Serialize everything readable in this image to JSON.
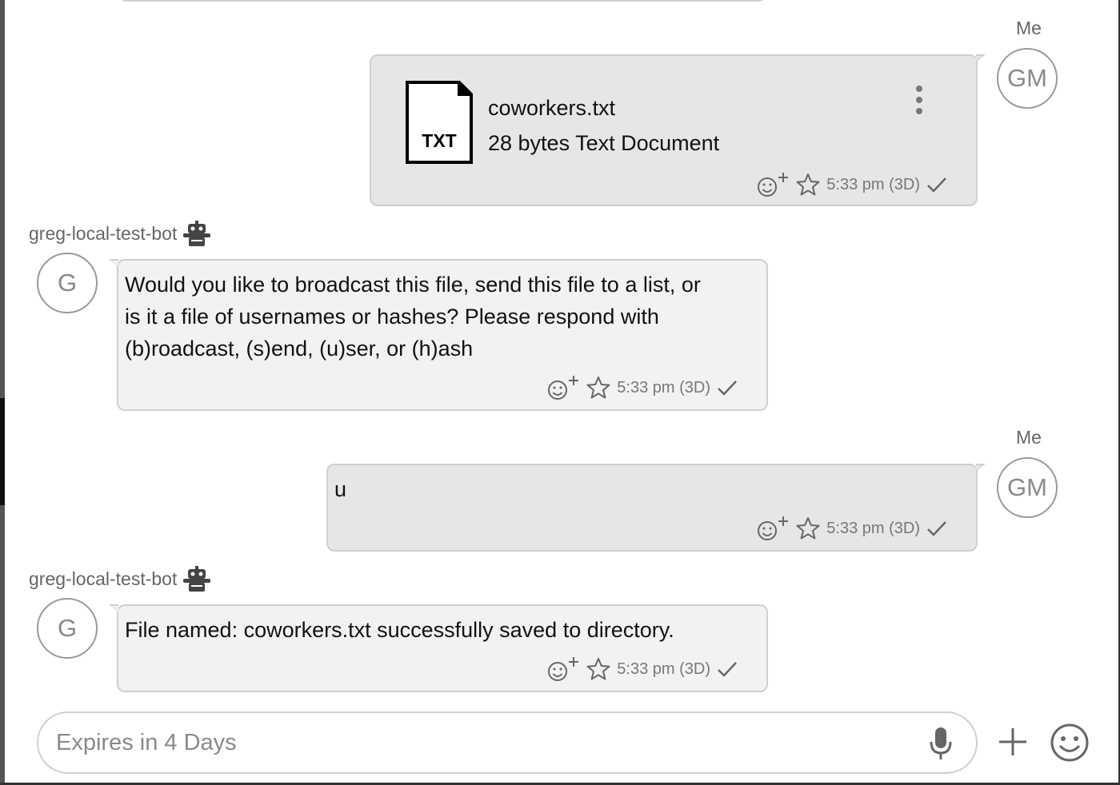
{
  "messages": [
    {
      "kind": "file",
      "sender": "Me",
      "avatar": "GM",
      "file": {
        "type_label": "TXT",
        "name": "coworkers.txt",
        "info": "28 bytes Text Document"
      },
      "time": "5:33 pm (3D)"
    },
    {
      "kind": "text",
      "sender": "greg-local-test-bot",
      "avatar": "G",
      "lines": [
        "Would you like to broadcast this file, send this file to a list, or",
        "is it a file of usernames or hashes? Please respond with",
        "(b)roadcast, (s)end, (u)ser, or (h)ash"
      ],
      "time": "5:33 pm (3D)"
    },
    {
      "kind": "text",
      "sender": "Me",
      "avatar": "GM",
      "lines": [
        "u"
      ],
      "time": "5:33 pm (3D)"
    },
    {
      "kind": "text",
      "sender": "greg-local-test-bot",
      "avatar": "G",
      "lines": [
        "File named: coworkers.txt successfully saved to directory."
      ],
      "time": "5:33 pm (3D)"
    }
  ],
  "composer": {
    "placeholder": "Expires in 4 Days"
  },
  "icons": {
    "bot": "robot-icon",
    "reaction": "add-reaction-icon",
    "star": "star-icon",
    "sent": "checkmark-icon",
    "menu": "kebab-menu-icon",
    "mic": "microphone-icon",
    "attach": "plus-icon",
    "emoji": "emoji-icon",
    "file": "txt-file-icon"
  },
  "colors": {
    "bubble_me": "#e6e6e6",
    "bubble_bot": "#f2f2f2",
    "border": "#cfcfcf",
    "meta_text": "#777777"
  }
}
